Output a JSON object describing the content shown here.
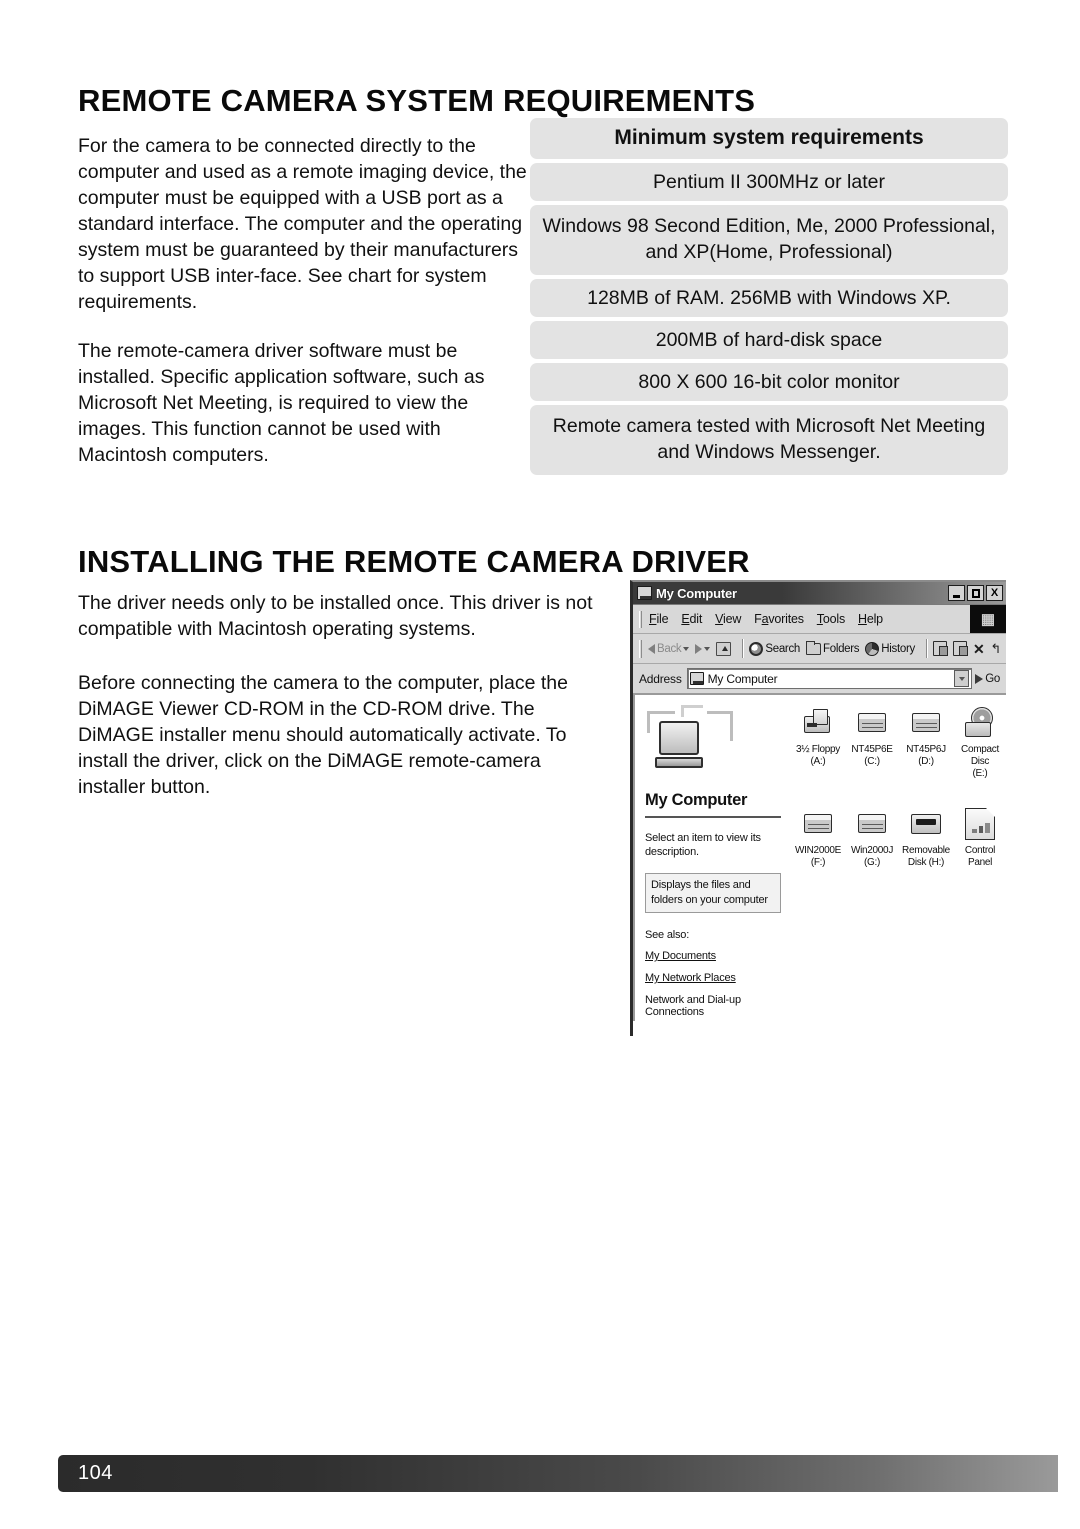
{
  "page": {
    "number": "104"
  },
  "sections": [
    {
      "heading": "REMOTE CAMERA SYSTEM REQUIREMENTS",
      "paragraphs": [
        "For the camera to be connected directly to the computer and used as a remote imaging device, the computer must be equipped with a USB port as a standard interface. The computer and the operating system must be guaranteed by their manufacturers to support USB inter-face. See chart for system requirements.",
        "The remote-camera driver software must be installed. Specific application software, such as Microsoft Net Meeting, is required to view the images. This function cannot be used with Macintosh computers."
      ]
    },
    {
      "heading": "INSTALLING THE REMOTE CAMERA DRIVER",
      "paragraphs": [
        "The driver needs only to be installed once. This driver is not compatible with Macintosh operating systems.",
        "Before connecting the camera to the computer, place the DiMAGE Viewer CD-ROM in the CD-ROM drive. The DiMAGE installer menu should automatically activate. To install the driver, click on the DiMAGE remote-camera installer button."
      ]
    }
  ],
  "requirements_table": {
    "header": "Minimum system requirements",
    "rows": [
      "Pentium II 300MHz or later",
      "Windows 98 Second Edition, Me, 2000 Professional, and XP(Home, Professional)",
      "128MB of RAM. 256MB with Windows XP.",
      "200MB of hard-disk space",
      "800 X 600 16-bit color monitor",
      "Remote camera tested with Microsoft Net Meeting and Windows Messenger."
    ]
  },
  "windows_screenshot": {
    "titlebar": {
      "title": "My Computer",
      "minimize_label": "_",
      "maximize_label": "□",
      "close_label": "X"
    },
    "menubar": [
      {
        "label": "File",
        "accel": "F"
      },
      {
        "label": "Edit",
        "accel": "E"
      },
      {
        "label": "View",
        "accel": "V"
      },
      {
        "label": "Favorites",
        "accel": "a"
      },
      {
        "label": "Tools",
        "accel": "T"
      },
      {
        "label": "Help",
        "accel": "H"
      }
    ],
    "toolbar": [
      {
        "label": "Back",
        "icon": "arrow-left-icon"
      },
      {
        "label": "",
        "icon": "arrow-right-icon"
      },
      {
        "label": "",
        "icon": "up-folder-icon"
      },
      {
        "label": "Search",
        "icon": "search-icon"
      },
      {
        "label": "Folders",
        "icon": "folders-icon"
      },
      {
        "label": "History",
        "icon": "history-icon"
      },
      {
        "label": "",
        "icon": "move-to-icon"
      },
      {
        "label": "",
        "icon": "copy-to-icon"
      },
      {
        "label": "",
        "icon": "delete-icon"
      },
      {
        "label": "",
        "icon": "undo-icon"
      },
      {
        "label": "",
        "icon": "views-icon"
      }
    ],
    "addressbar": {
      "label": "Address",
      "value": "My Computer",
      "go_label": "Go"
    },
    "left_panel": {
      "title": "My Computer",
      "description": "Select an item to view its description.",
      "tooltip": "Displays the files and folders on your computer",
      "see_also_label": "See also:",
      "links": [
        "My Documents",
        "My Network Places",
        "Network and Dial-up Connections"
      ]
    },
    "drives": [
      [
        {
          "name": "3½ Floppy",
          "letter": "(A:)",
          "icon": "floppy-drive-icon"
        },
        {
          "name": "NT45P6E",
          "letter": "(C:)",
          "icon": "hard-disk-icon"
        },
        {
          "name": "NT45P6J",
          "letter": "(D:)",
          "icon": "hard-disk-icon"
        },
        {
          "name": "Compact Disc",
          "letter": "(E:)",
          "icon": "cd-drive-icon"
        }
      ],
      [
        {
          "name": "WIN2000E",
          "letter": "(F:)",
          "icon": "hard-disk-icon"
        },
        {
          "name": "Win2000J",
          "letter": "(G:)",
          "icon": "hard-disk-icon"
        },
        {
          "name": "Removable",
          "letter": "Disk (H:)",
          "icon": "removable-disk-icon"
        },
        {
          "name": "Control Panel",
          "letter": "",
          "icon": "control-panel-icon"
        }
      ]
    ]
  },
  "colors": {
    "table_row_bg": "#e3e3e3",
    "footer_dark": "#2b2b2b",
    "text": "#111111",
    "window_chrome": "#d8d8d8"
  }
}
